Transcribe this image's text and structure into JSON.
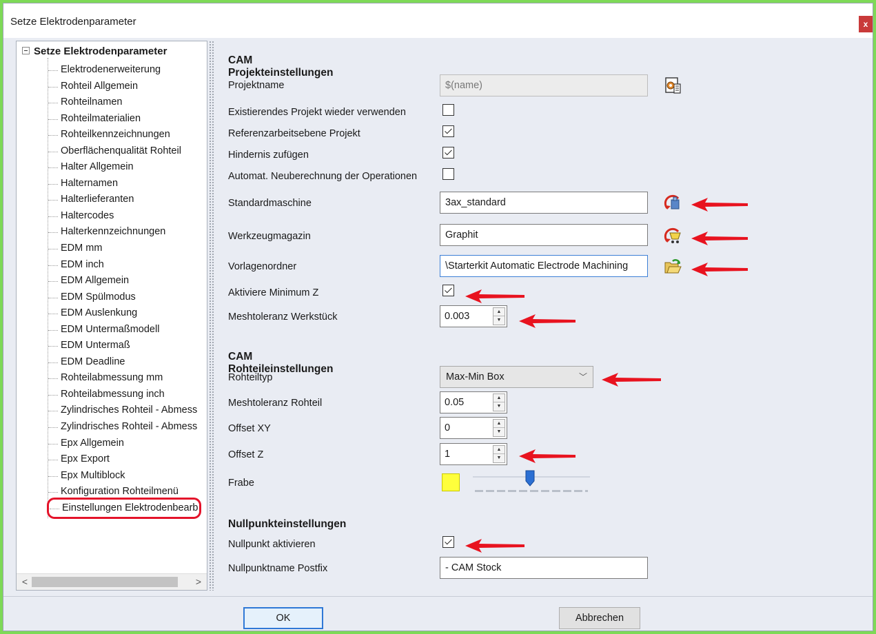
{
  "window": {
    "title": "Setze Elektrodenparameter",
    "close_label": "x"
  },
  "tree": {
    "root_label": "Setze Elektrodenparameter",
    "items": [
      "Elektrodenerweiterung",
      "Rohteil Allgemein",
      "Rohteilnamen",
      "Rohteilmaterialien",
      "Rohteilkennzeichnungen",
      "Oberflächenqualität Rohteil",
      "Halter Allgemein",
      "Halternamen",
      "Halterlieferanten",
      "Haltercodes",
      "Halterkennzeichnungen",
      "EDM mm",
      "EDM inch",
      "EDM Allgemein",
      "EDM Spülmodus",
      "EDM Auslenkung",
      "EDM Untermaßmodell",
      "EDM Untermaß",
      "EDM Deadline",
      "Rohteilabmessung mm",
      "Rohteilabmessung inch",
      "Zylindrisches Rohteil - Abmess",
      "Zylindrisches Rohteil - Abmess",
      "Epx Allgemein",
      "Epx Export",
      "Epx Multiblock",
      "Konfiguration Rohteilmenü",
      "Einstellungen Elektrodenbearb"
    ],
    "selected_index": 27,
    "scroll_left": "<",
    "scroll_right": ">"
  },
  "cam_project": {
    "title": "CAM Projekteinstellungen",
    "project_name_label": "Projektname",
    "project_name_value": "$(name)",
    "reuse_label": "Existierendes Projekt wieder verwenden",
    "reuse_checked": false,
    "ref_plane_label": "Referenzarbeitsebene Projekt",
    "ref_plane_checked": true,
    "obstacle_label": "Hindernis zufügen",
    "obstacle_checked": true,
    "recalc_label": "Automat. Neuberechnung der Operationen",
    "recalc_checked": false,
    "machine_label": "Standardmaschine",
    "machine_value": "3ax_standard",
    "magazine_label": "Werkzeugmagazin",
    "magazine_value": "Graphit",
    "template_label": "Vorlagenordner",
    "template_value": "\\Starterkit Automatic Electrode Machining",
    "minz_label": "Aktiviere Minimum Z",
    "minz_checked": true,
    "mesh_workpiece_label": "Meshtoleranz Werkstück",
    "mesh_workpiece_value": "0.003"
  },
  "cam_stock": {
    "title": "CAM Rohteileinstellungen",
    "type_label": "Rohteiltyp",
    "type_value": "Max-Min Box",
    "mesh_label": "Meshtoleranz Rohteil",
    "mesh_value": "0.05",
    "offset_xy_label": "Offset XY",
    "offset_xy_value": "0",
    "offset_z_label": "Offset Z",
    "offset_z_value": "1",
    "color_label": "Frabe",
    "color_value": "#ffff3c",
    "slider_fraction": 0.49
  },
  "zero_point": {
    "title": "Nullpunkteinstellungen",
    "activate_label": "Nullpunkt aktivieren",
    "activate_checked": true,
    "postfix_label": "Nullpunktname Postfix",
    "postfix_value": "- CAM Stock"
  },
  "buttons": {
    "ok": "OK",
    "cancel": "Abbrechen"
  },
  "colors": {
    "annotation_arrow": "#e8131f",
    "highlight_border": "#e4132a",
    "accent": "#2f78d6"
  }
}
